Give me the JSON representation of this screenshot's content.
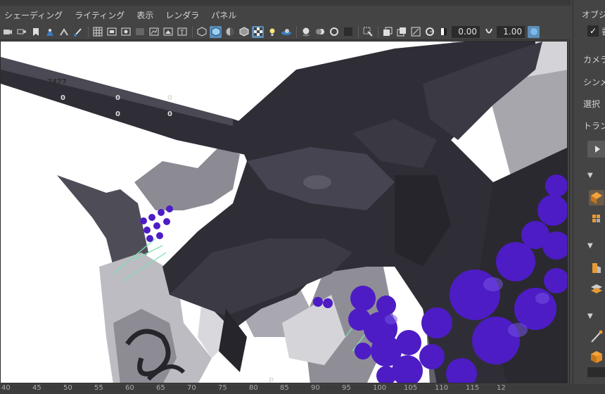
{
  "panel_menu": {
    "items": [
      "シェーディング",
      "ライティング",
      "表示",
      "レンダラ",
      "パネル"
    ]
  },
  "toolbar": {
    "icons": [
      "camera-select-icon",
      "camera-attributes-icon",
      "bookmark-icon",
      "image-plane-icon",
      "two-d-pan-icon",
      "grease-pencil-icon",
      "grid-icon",
      "film-gate-icon",
      "resolution-gate-icon",
      "gate-mask-icon",
      "field-chart-icon",
      "safe-action-icon",
      "safe-title-icon",
      "wireframe-icon",
      "smooth-shade-icon",
      "default-material-icon",
      "wireframe-on-shaded-icon",
      "textured-icon",
      "use-all-lights-icon",
      "shadows-icon",
      "screen-space-ao-icon",
      "motion-blur-icon",
      "multisample-aa-icon",
      "depth-of-field-icon",
      "isolate-select-icon",
      "xray-icon",
      "xray-active-icon",
      "xray-joints-icon",
      "backface-culling-icon",
      "exposure-icon",
      "gamma-icon",
      "color-management-icon"
    ],
    "exposure_value": "0.00",
    "gamma_value": "1.00"
  },
  "hud": {
    "row1": [
      "7477"
    ],
    "row2": [
      "0",
      "0"
    ],
    "row3": [
      "0",
      "0"
    ],
    "partial_0": "0",
    "partial_p": "p"
  },
  "timeline": {
    "ticks": [
      "40",
      "45",
      "50",
      "55",
      "60",
      "65",
      "70",
      "75",
      "80",
      "85",
      "90",
      "95",
      "100",
      "105",
      "110",
      "115",
      "12"
    ]
  },
  "side_panel": {
    "tab_label": "オブジ",
    "check_mark": "✓",
    "check_label": "書",
    "rows": [
      "カメラ",
      "シンメ",
      "選択",
      "トラン"
    ],
    "play_icon": "play-icon",
    "section_triangles": [
      "▼",
      "▼",
      "▼",
      "▼"
    ]
  },
  "colors": {
    "dragon_dark": "#2f2e37",
    "dragon_mid": "#4a4954",
    "beads": "#4d1cc4",
    "beads_highlight": "#7552e8",
    "accent_blue": "#5d8fb9",
    "ui_bg": "#444444"
  }
}
